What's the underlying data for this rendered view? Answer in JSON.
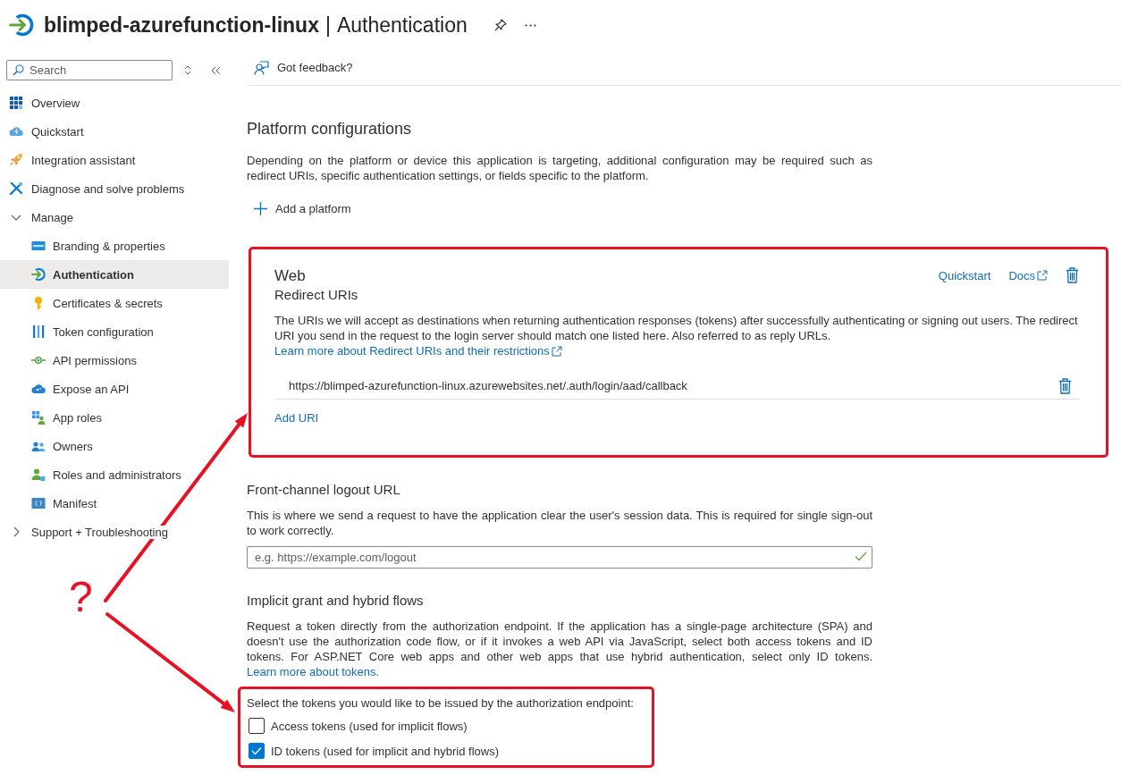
{
  "header": {
    "resource": "blimped-azurefunction-linux",
    "separator": "|",
    "page": "Authentication"
  },
  "sidebar": {
    "search": {
      "placeholder": "Search"
    },
    "items": [
      {
        "label": "Overview",
        "kind": "link",
        "selected": false
      },
      {
        "label": "Quickstart",
        "kind": "link",
        "selected": false
      },
      {
        "label": "Integration assistant",
        "kind": "link",
        "selected": false
      },
      {
        "label": "Diagnose and solve problems",
        "kind": "link",
        "selected": false
      },
      {
        "label": "Manage",
        "kind": "group",
        "selected": false,
        "expanded": true,
        "children": [
          {
            "label": "Branding & properties",
            "selected": false
          },
          {
            "label": "Authentication",
            "selected": true
          },
          {
            "label": "Certificates & secrets",
            "selected": false
          },
          {
            "label": "Token configuration",
            "selected": false
          },
          {
            "label": "API permissions",
            "selected": false
          },
          {
            "label": "Expose an API",
            "selected": false
          },
          {
            "label": "App roles",
            "selected": false
          },
          {
            "label": "Owners",
            "selected": false
          },
          {
            "label": "Roles and administrators",
            "selected": false
          },
          {
            "label": "Manifest",
            "selected": false
          }
        ]
      },
      {
        "label": "Support + Troubleshooting",
        "kind": "group",
        "selected": false,
        "expanded": false
      }
    ]
  },
  "toolbar": {
    "feedback": "Got feedback?"
  },
  "platform_configurations": {
    "title": "Platform configurations",
    "description": "Depending on the platform or device this application is targeting, additional configuration may be required such as redirect URIs, specific authentication settings, or fields specific to the platform.",
    "add_button": "Add a platform"
  },
  "web_platform": {
    "title": "Web",
    "subtitle": "Redirect URIs",
    "links": [
      {
        "label": "Quickstart",
        "external": false
      },
      {
        "label": "Docs",
        "external": true
      }
    ],
    "description": {
      "text": "The URIs we will accept as destinations when returning authentication responses (tokens) after successfully authenticating or signing out users. The redirect URI you send in the request to the login server should match one listed here. Also referred to as reply URLs.",
      "link": {
        "label": "Learn more about Redirect URIs and their restrictions",
        "external": true
      }
    },
    "redirect_uris": [
      "https://blimped-azurefunction-linux.azurewebsites.net/.auth/login/aad/callback"
    ],
    "add_uri": "Add URI"
  },
  "front_channel_logout": {
    "title": "Front-channel logout URL",
    "description": "This is where we send a request to have the application clear the user's session data. This is required for single sign-out to work correctly.",
    "field": {
      "placeholder": "e.g. https://example.com/logout",
      "valid": true
    }
  },
  "implicit_grant": {
    "title": "Implicit grant and hybrid flows",
    "description": {
      "text": "Request a token directly from the authorization endpoint. If the application has a single-page architecture (SPA) and doesn't use the authorization code flow, or if it invokes a web API via JavaScript, select both access tokens and ID tokens. For ASP.NET Core web apps and other web apps that use hybrid authentication, select only ID tokens.",
      "link": {
        "label": "Learn more about tokens.",
        "external": false
      }
    },
    "prompt": "Select the tokens you would like to be issued by the authorization endpoint:",
    "options": [
      {
        "label": "Access tokens (used for implicit flows)",
        "checked": false
      },
      {
        "label": "ID tokens (used for implicit and hybrid flows)",
        "checked": true
      }
    ]
  },
  "annotation": {
    "mark": "?"
  }
}
